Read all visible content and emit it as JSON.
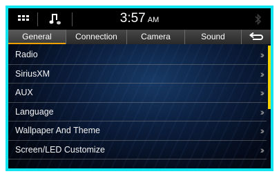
{
  "header": {
    "time": "3:57",
    "ampm": "AM"
  },
  "tabs": [
    {
      "label": "General",
      "active": true
    },
    {
      "label": "Connection",
      "active": false
    },
    {
      "label": "Camera",
      "active": false
    },
    {
      "label": "Sound",
      "active": false
    }
  ],
  "menu": {
    "items": [
      {
        "label": "Radio"
      },
      {
        "label": "SiriusXM"
      },
      {
        "label": "AUX"
      },
      {
        "label": "Language"
      },
      {
        "label": "Wallpaper And Theme"
      },
      {
        "label": "Screen/LED Customize"
      }
    ]
  },
  "colors": {
    "frame_border": "#11e4ee",
    "active_tab_accent": "#f0a000",
    "scrollbar": "#f4d400"
  },
  "icons": {
    "apps": "apps-grid-icon",
    "music": "music-note-icon",
    "bluetooth": "bluetooth-icon",
    "back": "back-arrow-icon",
    "chevron": "double-chevron-right-icon"
  }
}
